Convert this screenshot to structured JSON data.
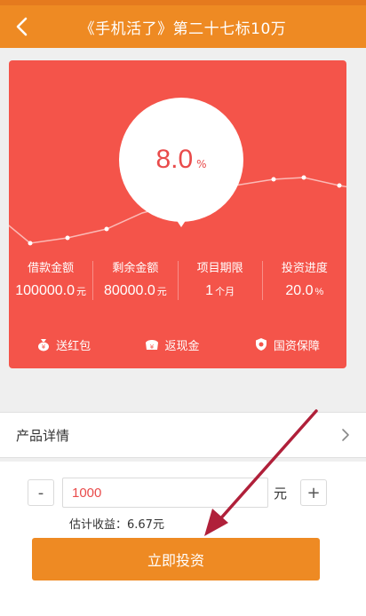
{
  "header": {
    "title": "《手机活了》第二十七标10万",
    "back_icon": "chevron-left-icon"
  },
  "card": {
    "rate": {
      "value": "8.0",
      "unit": "%"
    },
    "stats": [
      {
        "label": "借款金额",
        "value": "100000.0",
        "unit": "元"
      },
      {
        "label": "剩余金额",
        "value": "80000.0",
        "unit": "元"
      },
      {
        "label": "项目期限",
        "value": "1",
        "unit": "个月"
      },
      {
        "label": "投资进度",
        "value": "20.0",
        "unit": "%"
      }
    ],
    "features": [
      {
        "label": "送红包",
        "icon": "money-bag-icon"
      },
      {
        "label": "返现金",
        "icon": "cash-back-icon"
      },
      {
        "label": "国资保障",
        "icon": "shield-icon"
      }
    ]
  },
  "detail": {
    "label": "产品详情",
    "icon": "chevron-right-icon"
  },
  "invest": {
    "minus_label": "-",
    "plus_label": "+",
    "amount": "1000",
    "amount_unit": "元",
    "estimate": "估计收益：6.67元",
    "button_label": "立即投资"
  },
  "colors": {
    "header": "#ee8a23",
    "card": "#f4544a",
    "rate_text": "#e94b4b",
    "button": "#ee8a23",
    "annotation_arrow": "#b0203a"
  }
}
